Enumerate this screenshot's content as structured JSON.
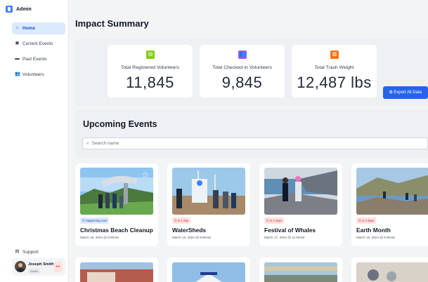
{
  "brand": {
    "name": "Admin"
  },
  "sidebar": {
    "items": [
      {
        "label": "Home",
        "icon": "home-icon",
        "glyph": "⌂",
        "active": true
      },
      {
        "label": "Current Events",
        "icon": "calendar-icon",
        "glyph": "▣",
        "active": false
      },
      {
        "label": "Past Events",
        "icon": "folder-icon",
        "glyph": "▬",
        "active": false
      },
      {
        "label": "Volunteers",
        "icon": "users-icon",
        "glyph": "👥",
        "active": false
      }
    ],
    "support_label": "Support"
  },
  "user": {
    "name": "Joseph Smith",
    "role": "Admin"
  },
  "main": {
    "title": "Impact Summary",
    "stats": [
      {
        "label": "Total Registered Volunteers",
        "value": "11,845",
        "icon": "clipboard-icon",
        "glyph": "▤",
        "color": "#84cc16"
      },
      {
        "label": "Total Checked-In Volunteers",
        "value": "9,845",
        "icon": "users-icon",
        "glyph": "👥",
        "color": "#8b5cf6"
      },
      {
        "label": "Total Trash Weight",
        "value": "12,487 lbs",
        "icon": "trash-icon",
        "glyph": "▥",
        "color": "#f97316"
      }
    ],
    "export_label": "Export All Data"
  },
  "upcoming": {
    "title": "Upcoming Events",
    "search_placeholder": "Search name",
    "events": [
      {
        "badge": "Happening now",
        "name": "Christmas Beach Cleanup",
        "date": "March 15, 2024 @ 8:00AM"
      },
      {
        "badge": "In 1 day",
        "name": "WaterSheds",
        "date": "March 16, 2024 @ 9:00AM"
      },
      {
        "badge": "In 2 days",
        "name": "Festival of Whales",
        "date": "March 17, 2024 @ 11:00AM"
      },
      {
        "badge": "In 3 days",
        "name": "Earth Month",
        "date": "March 18, 2024 @ 9:30AM"
      }
    ]
  }
}
